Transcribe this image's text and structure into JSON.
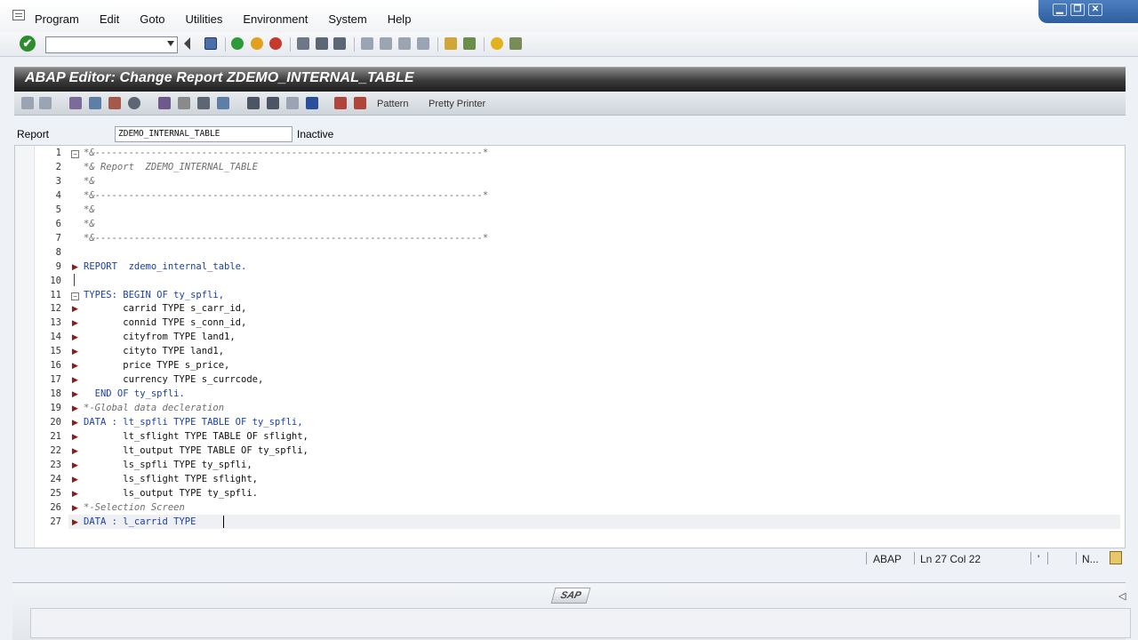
{
  "menu": [
    "Program",
    "Edit",
    "Goto",
    "Utilities",
    "Environment",
    "System",
    "Help"
  ],
  "window_buttons": {
    "minimize": "▁",
    "restore": "❐",
    "close": "✕"
  },
  "title": "ABAP Editor: Change Report ZDEMO_INTERNAL_TABLE",
  "app_toolbar": {
    "pattern": "Pattern",
    "pretty_printer": "Pretty Printer"
  },
  "report": {
    "label": "Report",
    "value": "ZDEMO_INTERNAL_TABLE",
    "status": "Inactive"
  },
  "editor": {
    "lines": [
      {
        "n": "1",
        "text": "*&---------------------------------------------------------------------*",
        "style": "comment"
      },
      {
        "n": "2",
        "text": "*& Report  ZDEMO_INTERNAL_TABLE",
        "style": "comment"
      },
      {
        "n": "3",
        "text": "*&",
        "style": "comment"
      },
      {
        "n": "4",
        "text": "*&---------------------------------------------------------------------*",
        "style": "comment"
      },
      {
        "n": "5",
        "text": "*&",
        "style": "comment"
      },
      {
        "n": "6",
        "text": "*&",
        "style": "comment"
      },
      {
        "n": "7",
        "text": "*&---------------------------------------------------------------------*",
        "style": "comment"
      },
      {
        "n": "8",
        "text": "",
        "style": "plain"
      },
      {
        "n": "9",
        "text": "REPORT  zdemo_internal_table.",
        "style": "kw"
      },
      {
        "n": "10",
        "text": "",
        "style": "plain"
      },
      {
        "n": "11",
        "text": "TYPES: BEGIN OF ty_spfli,",
        "style": "kw"
      },
      {
        "n": "12",
        "text": "       carrid TYPE s_carr_id,",
        "style": "plain"
      },
      {
        "n": "13",
        "text": "       connid TYPE s_conn_id,",
        "style": "plain"
      },
      {
        "n": "14",
        "text": "       cityfrom TYPE land1,",
        "style": "plain"
      },
      {
        "n": "15",
        "text": "       cityto TYPE land1,",
        "style": "plain"
      },
      {
        "n": "16",
        "text": "       price TYPE s_price,",
        "style": "plain"
      },
      {
        "n": "17",
        "text": "       currency TYPE s_currcode,",
        "style": "plain"
      },
      {
        "n": "18",
        "text": "  END OF ty_spfli.",
        "style": "kw"
      },
      {
        "n": "19",
        "text": "*-Global data decleration",
        "style": "comment"
      },
      {
        "n": "20",
        "text": "DATA : lt_spfli TYPE TABLE OF ty_spfli,",
        "style": "kw"
      },
      {
        "n": "21",
        "text": "       lt_sflight TYPE TABLE OF sflight,",
        "style": "plain"
      },
      {
        "n": "22",
        "text": "       lt_output TYPE TABLE OF ty_spfli,",
        "style": "plain"
      },
      {
        "n": "23",
        "text": "       ls_spfli TYPE ty_spfli,",
        "style": "plain"
      },
      {
        "n": "24",
        "text": "       ls_sflight TYPE sflight,",
        "style": "plain"
      },
      {
        "n": "25",
        "text": "       ls_output TYPE ty_spfli.",
        "style": "plain"
      },
      {
        "n": "26",
        "text": "*-Selection Screen",
        "style": "comment"
      },
      {
        "n": "27",
        "text": "DATA : l_carrid TYPE ",
        "style": "kw"
      }
    ]
  },
  "status_bar": {
    "language": "ABAP",
    "cursor": "Ln  27 Col  22",
    "mode_mark": "'",
    "mode": "N..."
  },
  "footer": {
    "logo": "SAP"
  }
}
